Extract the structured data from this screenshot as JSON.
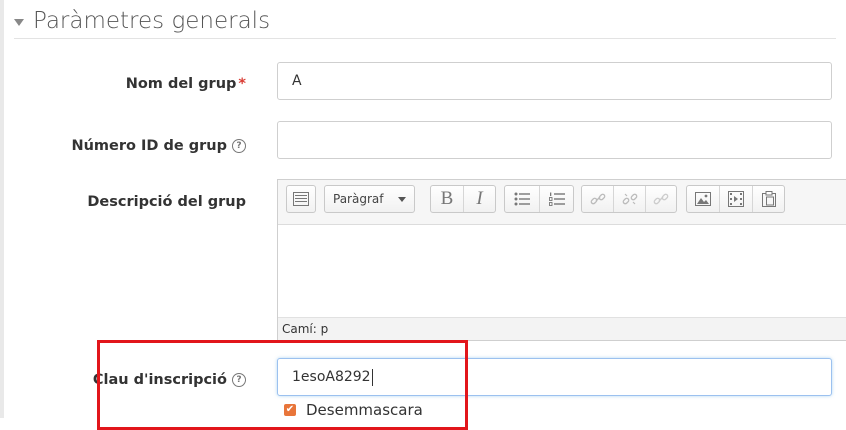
{
  "section": {
    "title": "Paràmetres generals"
  },
  "fields": {
    "group_name": {
      "label": "Nom del grup",
      "required_marker": "*",
      "value": "A"
    },
    "group_id": {
      "label": "Número ID de grup",
      "help": "?",
      "value": ""
    },
    "description": {
      "label": "Descripció del grup",
      "format_select": "Paràgraf",
      "path": "Camí: p"
    },
    "enrolment_key": {
      "label": "Clau d'inscripció",
      "help": "?",
      "value": "1esoA8292"
    }
  },
  "unmask": {
    "label": "Desemmascara",
    "checked": true,
    "check_glyph": "✔"
  },
  "toolbar": {
    "icons": [
      "toggle-toolbar-icon",
      "bold-icon",
      "italic-icon",
      "bullet-list-icon",
      "numbered-list-icon",
      "link-icon",
      "unlink-icon",
      "anchor-icon",
      "image-icon",
      "media-icon",
      "paste-icon"
    ],
    "bold": "B",
    "italic": "I"
  },
  "colors": {
    "required": "#d93c33",
    "highlight": "#e2161b",
    "checkbox": "#e8753a",
    "focus_border": "#9cc1ef"
  }
}
